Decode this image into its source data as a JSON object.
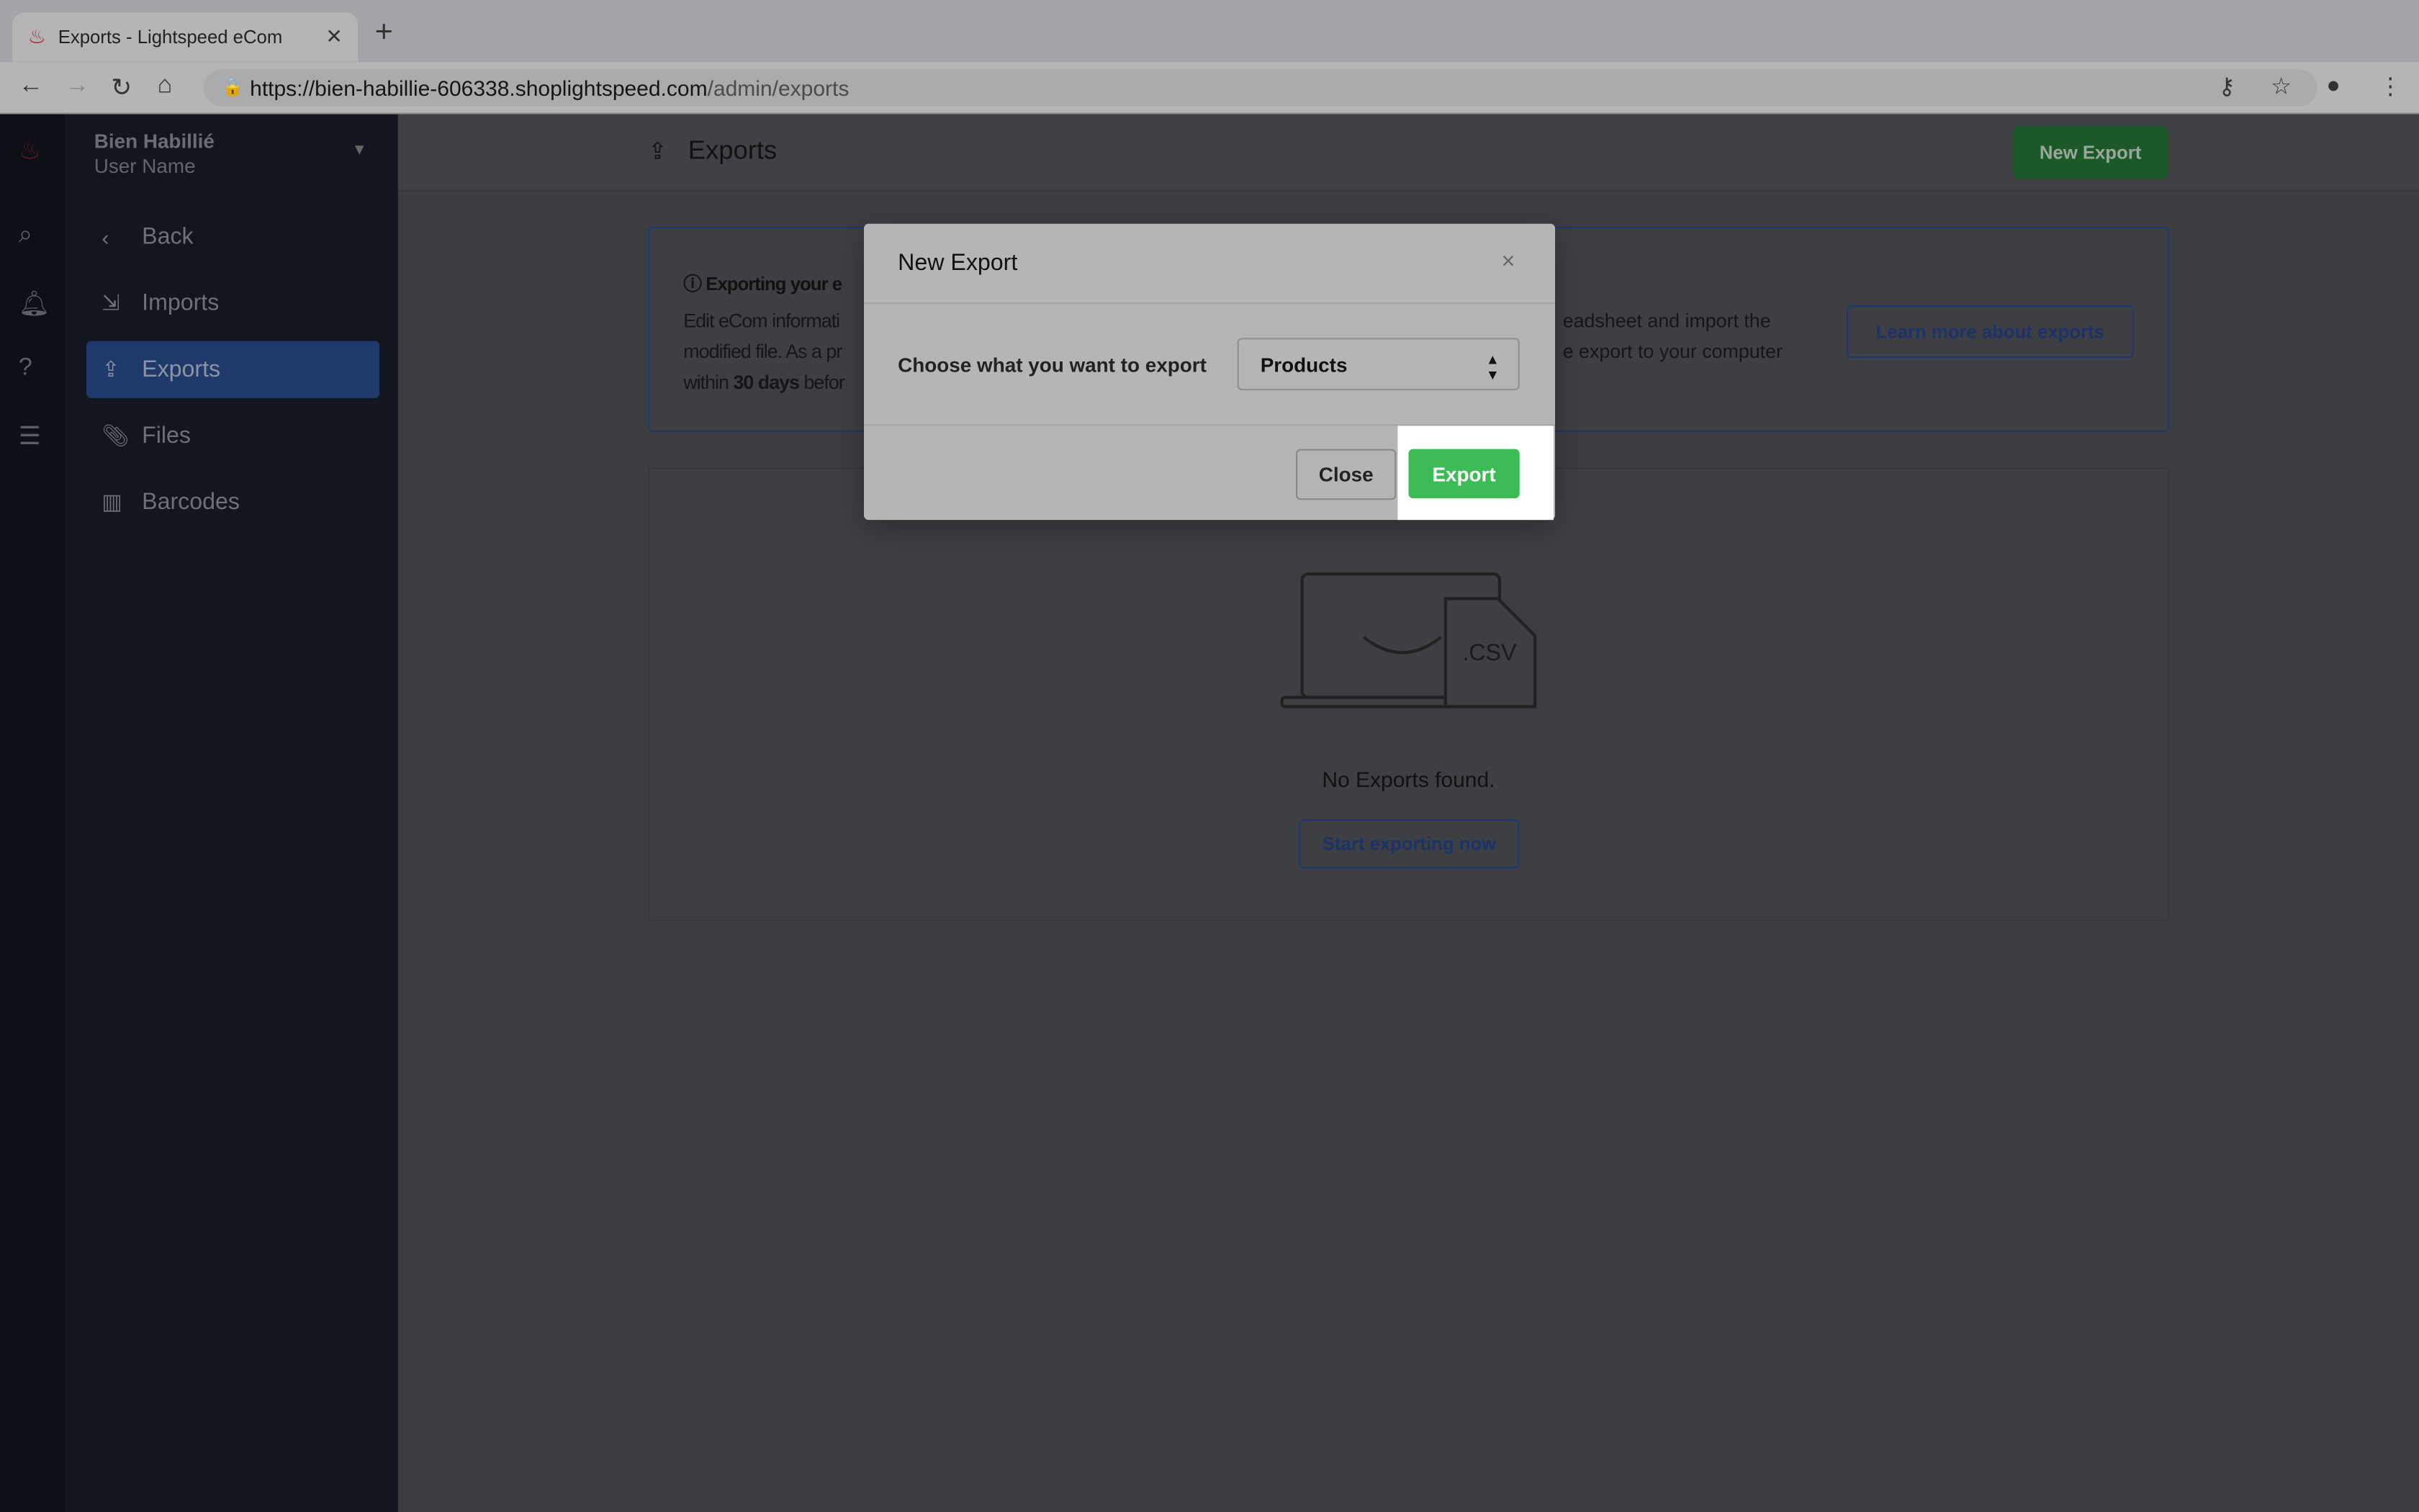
{
  "browser": {
    "tab_title": "Exports - Lightspeed eCom",
    "url_host": "https://bien-habillie-606338.shoplightspeed.com",
    "url_path": "/admin/exports"
  },
  "sidebar": {
    "store": "Bien Habillié",
    "user": "User Name",
    "items": [
      {
        "label": "Back",
        "icon": "chevron-left-icon"
      },
      {
        "label": "Imports",
        "icon": "import-icon"
      },
      {
        "label": "Exports",
        "icon": "export-icon",
        "active": true
      },
      {
        "label": "Files",
        "icon": "paperclip-icon"
      },
      {
        "label": "Barcodes",
        "icon": "barcode-icon"
      }
    ]
  },
  "header": {
    "title": "Exports",
    "new_export": "New Export"
  },
  "info": {
    "title": "Exporting your e",
    "l1a": "Edit eCom informati",
    "l1b": "eadsheet and import the",
    "l2a": "modified file. As a pr",
    "l2b": "e export to your computer",
    "l3a": "within ",
    "l3bold": "30 days",
    "l3c": " befor",
    "learn": "Learn more about exports"
  },
  "empty": {
    "csv": ".CSV",
    "message": "No Exports found.",
    "start": "Start exporting now"
  },
  "modal": {
    "title": "New Export",
    "label": "Choose what you want to export",
    "selected": "Products",
    "close": "Close",
    "export": "Export"
  },
  "colors": {
    "accent": "#3a6ed8",
    "green": "#3dbc56",
    "brand": "#d9333f"
  }
}
